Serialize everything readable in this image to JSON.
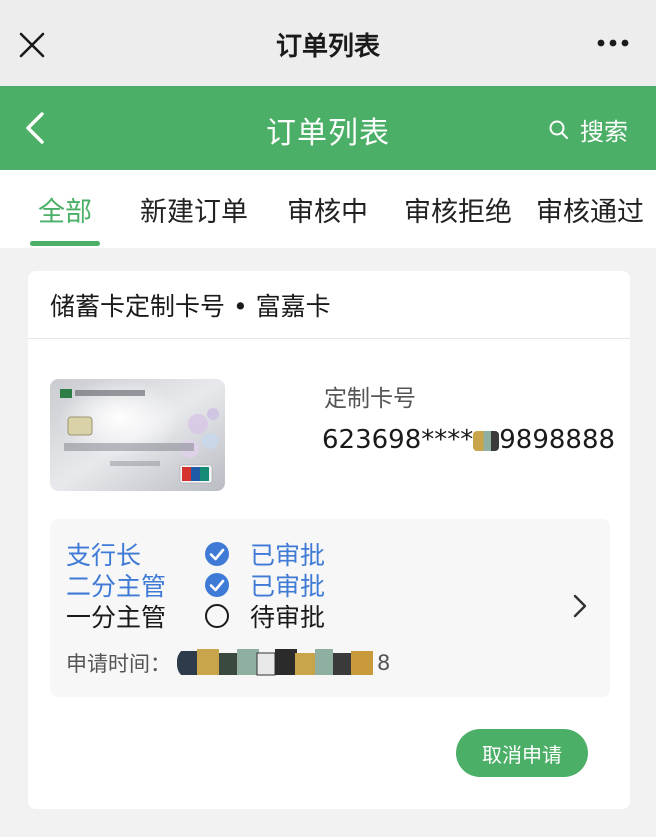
{
  "topbar": {
    "title": "订单列表",
    "close_icon": "close-icon",
    "more_icon": "more-icon"
  },
  "nav": {
    "title": "订单列表",
    "search_label": "搜索",
    "back_icon": "back-arrow-icon",
    "accent": "#4caf67"
  },
  "tabs": [
    {
      "label": "全部",
      "active": true
    },
    {
      "label": "新建订单",
      "active": false
    },
    {
      "label": "审核中",
      "active": false
    },
    {
      "label": "审核拒绝",
      "active": false
    },
    {
      "label": "审核通过",
      "active": false
    }
  ],
  "order": {
    "title": "储蓄卡定制卡号 • 富嘉卡",
    "card_image_icon": "bank-card-image",
    "card_number_label": "定制卡号",
    "card_number": "623698****",
    "card_number_tail": "9898888",
    "approvals": [
      {
        "role": "支行长",
        "status": "已审批",
        "state": "approved"
      },
      {
        "role": "二分主管",
        "status": "已审批",
        "state": "approved"
      },
      {
        "role": "一分主管",
        "status": "待审批",
        "state": "pending"
      }
    ],
    "apply_time_label": "申请时间：",
    "apply_time_tail": "8",
    "cancel_button": "取消申请"
  },
  "colors": {
    "green": "#4caf67",
    "approved_blue": "#3e7ad6",
    "bg": "#f2f2f2"
  }
}
